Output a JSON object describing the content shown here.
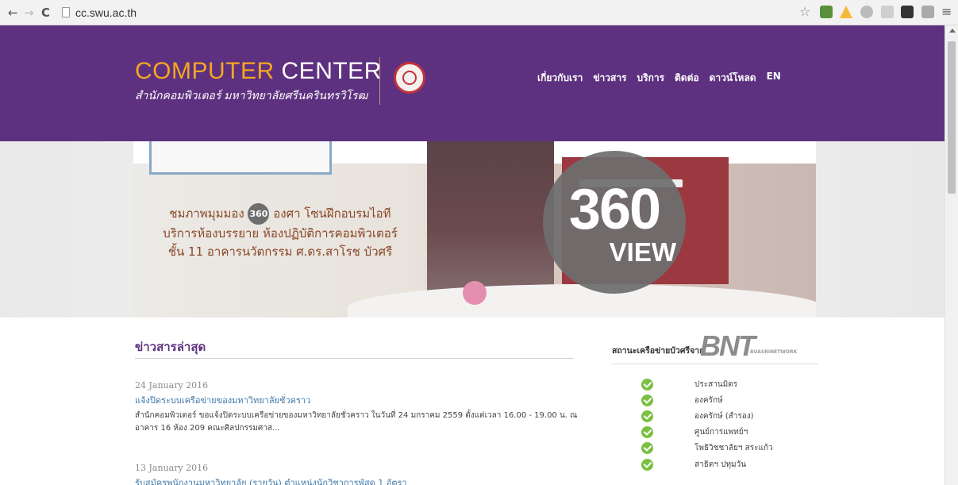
{
  "browser": {
    "url": "cc.swu.ac.th"
  },
  "header": {
    "logo_part1": "COMPUTER",
    "logo_part2": "CENTER",
    "logo_subtitle": "สำนักคอมพิวเตอร์ มหาวิทยาลัยศรีนครินทรวิโรฒ",
    "nav": [
      "เกี่ยวกับเรา",
      "ข่าวสาร",
      "บริการ",
      "ติดต่อ",
      "ดาวน์โหลด",
      "EN"
    ]
  },
  "hero": {
    "line1_before": "ชมภาพมุมมอง",
    "badge": "360",
    "line1_after": "องศา โซนฝึกอบรมไอที",
    "line2": "บริการห้องบรรยาย ห้องปฏิบัติการคอมพิวเตอร์",
    "line3": "ชั้น 11 อาคารนวัตกรรม ศ.ดร.สาโรช บัวศรี",
    "circle_big": "360",
    "circle_small": "VIEW"
  },
  "news": {
    "title": "ข่าวสารล่าสุด",
    "items": [
      {
        "date": "24 January 2016",
        "headline": "แจ้งปิดระบบเครือข่ายของมหาวิทยาลัยชั่วคราว",
        "desc": "สำนักคอมพิวเตอร์ ขอแจ้งปิดระบบเครือข่ายของมหาวิทยาลัยชั่วคราว ในวันที่ 24 มกราคม 2559 ตั้งแต่เวลา 16.00 - 19.00 น. ณ อาคาร 16 ห้อง 209 คณะศิลปกรรมศาส..."
      },
      {
        "date": "13 January 2016",
        "headline": "รับสมัครพนักงานมหาวิทยาลัย (รายวัน) ตำแหน่งนักวิชาการพัสดุ 1 อัตรา",
        "desc": ""
      }
    ]
  },
  "network": {
    "title": "สถานะเครือข่ายบัวศรีจาก",
    "logo": "BNT",
    "logo_sub": "BUASRINETWORK",
    "sites": [
      {
        "name": "ประสานมิตร",
        "status": "ok"
      },
      {
        "name": "องครักษ์",
        "status": "ok"
      },
      {
        "name": "องครักษ์ (สำรอง)",
        "status": "ok"
      },
      {
        "name": "ศูนย์การแพทย์ฯ",
        "status": "ok"
      },
      {
        "name": "โพธิวิชชาลัยฯ สระแก้ว",
        "status": "ok"
      },
      {
        "name": "สาธิตฯ ปทุมวัน",
        "status": "ok"
      }
    ]
  },
  "colors": {
    "header_bg": "#5d317f",
    "logo_orange": "#f5a623",
    "status_ok": "#7bc043",
    "link": "#3f7aaa"
  },
  "icons": [
    "back-arrow-icon",
    "forward-arrow-icon",
    "reload-icon",
    "page-icon",
    "bookmark-star-icon",
    "chrome-menu-icon",
    "check-circle-icon"
  ]
}
